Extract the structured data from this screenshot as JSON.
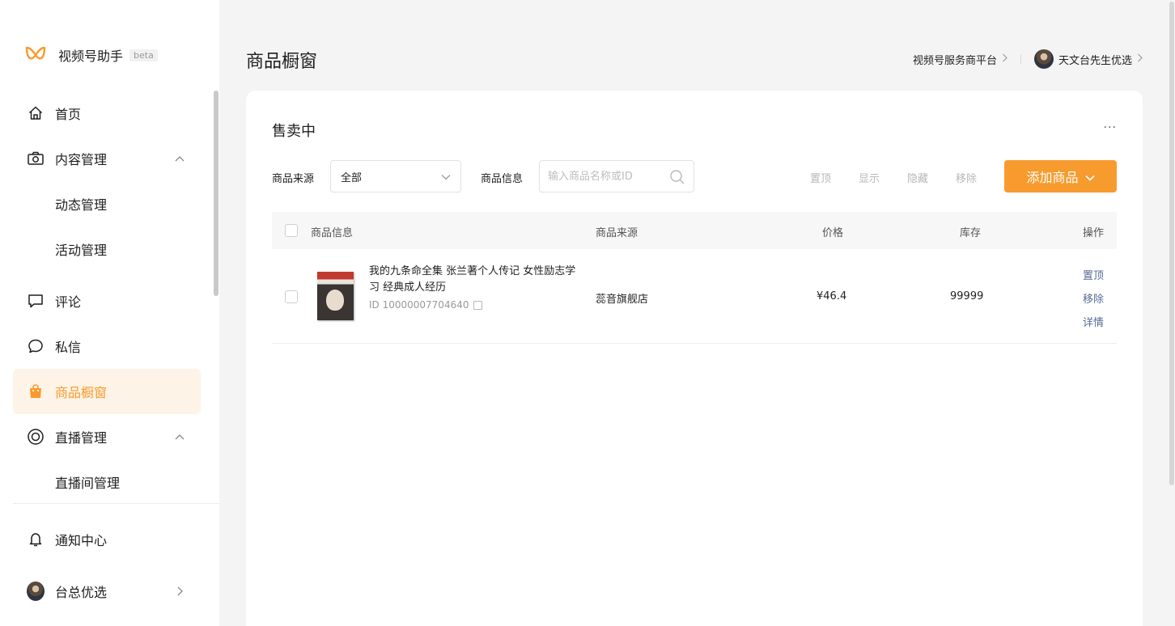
{
  "app": {
    "name": "视频号助手",
    "badge": "beta"
  },
  "sidebar": {
    "items": [
      {
        "label": "首页",
        "icon": "home-icon"
      },
      {
        "label": "内容管理",
        "icon": "camera-icon",
        "expanded": true
      },
      {
        "label": "动态管理"
      },
      {
        "label": "活动管理"
      },
      {
        "label": "评论",
        "icon": "comment-icon"
      },
      {
        "label": "私信",
        "icon": "message-icon"
      },
      {
        "label": "商品橱窗",
        "icon": "shopping-bag-icon",
        "active": true
      },
      {
        "label": "直播管理",
        "icon": "live-icon",
        "expanded": true
      },
      {
        "label": "直播间管理"
      }
    ],
    "bottom": [
      {
        "label": "通知中心",
        "icon": "bell-icon"
      },
      {
        "label": "台总优选",
        "icon": "avatar"
      }
    ]
  },
  "header": {
    "title": "商品橱窗",
    "service_link": "视频号服务商平台",
    "account_name": "天文台先生优选"
  },
  "card": {
    "title": "售卖中",
    "more": "···",
    "filters": {
      "source_label": "商品来源",
      "source_value": "全部",
      "info_label": "商品信息",
      "search_placeholder": "输入商品名称或ID"
    },
    "bulk_actions": [
      "置顶",
      "显示",
      "隐藏",
      "移除"
    ],
    "add_button": "添加商品",
    "table": {
      "headers": {
        "info": "商品信息",
        "source": "商品来源",
        "price": "价格",
        "stock": "库存",
        "ops": "操作"
      },
      "rows": [
        {
          "title": "我的九条命全集 张兰著个人传记 女性励志学习 经典成人经历",
          "id": "ID 10000007704640",
          "source": "蕊音旗舰店",
          "price": "¥46.4",
          "stock": "99999",
          "ops": [
            "置顶",
            "移除",
            "详情"
          ]
        }
      ]
    }
  },
  "colors": {
    "accent": "#f79b2e",
    "active_bg": "#fdf3e6",
    "link": "#576b95"
  }
}
